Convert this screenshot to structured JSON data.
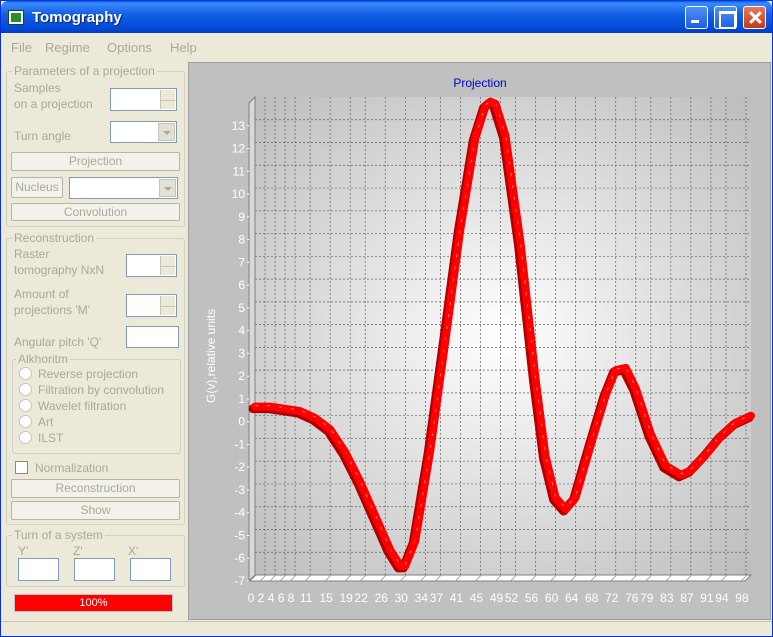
{
  "window": {
    "title": "Tomography"
  },
  "menu": [
    "File",
    "Regime",
    "Options",
    "Help"
  ],
  "projection_group": {
    "title": "Parameters of a projection",
    "samples_label_1": "Samples",
    "samples_label_2": "on a projection",
    "turn_angle_label": "Turn angle",
    "projection_button": "Projection",
    "nucleus_button": "Nucleus",
    "convolution_button": "Convolution"
  },
  "reconstruction_group": {
    "title": "Reconstruction",
    "raster_label_1": "Raster",
    "raster_label_2": "tomography NxN",
    "amount_label_1": "Amount of",
    "amount_label_2": "projections 'M'",
    "angular_label": "Angular pitch 'Q'",
    "algorithm_title": "Alkhoritm",
    "algorithms": [
      "Reverse projection",
      "Filtration by convolution",
      "Wavelet filtration",
      "Art",
      "ILST"
    ],
    "normalization_label": "Normalization",
    "reconstruction_button": "Reconstruction",
    "show_button": "Show"
  },
  "turn_group": {
    "title": "Turn of a system",
    "axis_labels": [
      "Y'",
      "Z'",
      "X'"
    ]
  },
  "progress": {
    "value": 1.0,
    "label": "100%"
  },
  "colors": {
    "curve": "#ff0000",
    "progress": "#fe0000",
    "chart_title": "#0000cc",
    "titlebar": "#0047d6"
  },
  "chart_data": {
    "type": "line",
    "title": "Projection",
    "ylabel": "G(v),relative units",
    "xlabel": "",
    "x_tick_labels": [
      "0",
      "2",
      "4",
      "6",
      "8",
      "11",
      "15",
      "19",
      "22",
      "26",
      "30",
      "34",
      "37",
      "41",
      "45",
      "49",
      "52",
      "56",
      "60",
      "64",
      "68",
      "72",
      "76",
      "79",
      "83",
      "87",
      "91",
      "94",
      "98"
    ],
    "x_tick_values": [
      0,
      2,
      4,
      6,
      8,
      11,
      15,
      19,
      22,
      26,
      30,
      34,
      37,
      41,
      45,
      49,
      52,
      56,
      60,
      64,
      68,
      72,
      76,
      79,
      83,
      87,
      91,
      94,
      98
    ],
    "y_tick_labels": [
      "-7",
      "-6",
      "-5",
      "-4",
      "-3",
      "-2",
      "-1",
      "0",
      "1",
      "2",
      "3",
      "4",
      "5",
      "6",
      "7",
      "8",
      "9",
      "10",
      "11",
      "12",
      "13"
    ],
    "xlim": [
      0,
      99
    ],
    "ylim": [
      -7,
      14
    ],
    "grid": true,
    "series": [
      {
        "x": [
          0,
          3,
          6,
          9,
          12,
          15,
          18,
          21,
          24,
          27,
          29,
          30,
          32,
          35,
          38,
          41,
          44,
          46,
          47,
          48,
          50,
          53,
          56,
          58,
          60,
          62,
          64,
          67,
          70,
          72,
          74,
          76,
          79,
          82,
          85,
          87,
          90,
          93,
          96,
          99
        ],
        "y": [
          0.4,
          0.4,
          0.3,
          0.2,
          -0.1,
          -0.6,
          -1.6,
          -2.9,
          -4.4,
          -5.9,
          -6.6,
          -6.6,
          -5.5,
          -1.5,
          3.3,
          8.2,
          12.2,
          13.6,
          13.8,
          13.7,
          12.3,
          7.6,
          1.6,
          -1.8,
          -3.6,
          -4.1,
          -3.6,
          -1.3,
          0.9,
          2.0,
          2.1,
          1.2,
          -0.8,
          -2.2,
          -2.6,
          -2.4,
          -1.7,
          -0.9,
          -0.3,
          0.0
        ]
      }
    ]
  }
}
